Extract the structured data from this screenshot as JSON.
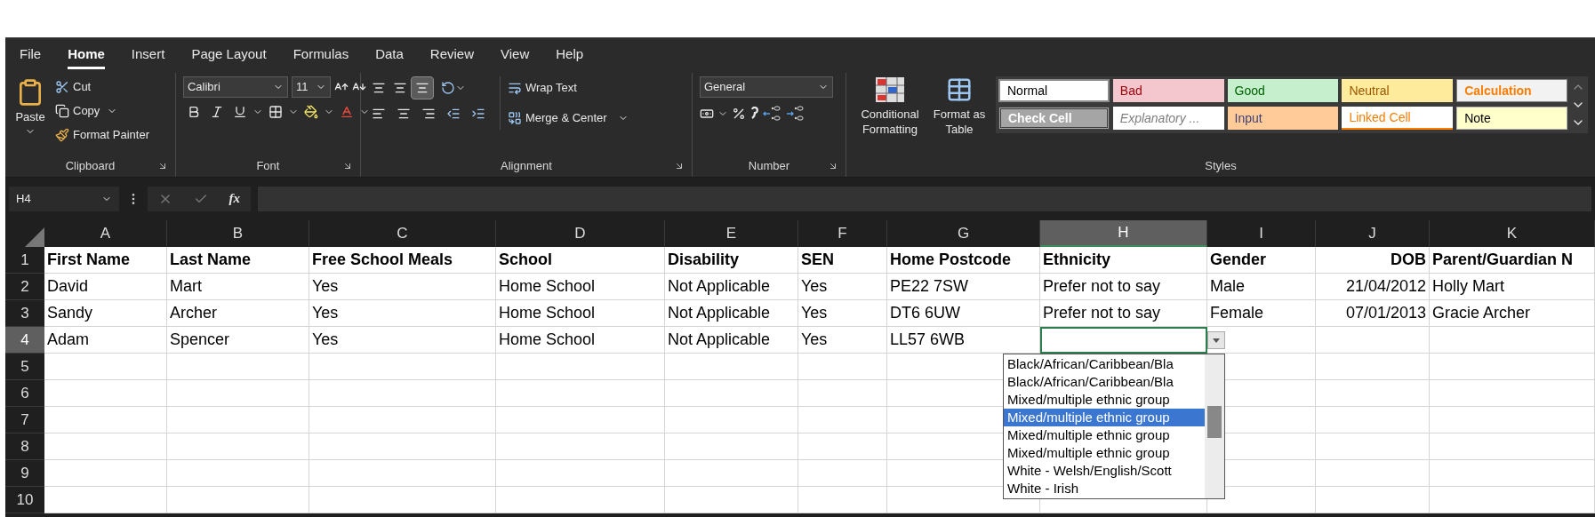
{
  "menu_tabs": [
    {
      "label": "File",
      "selected": false
    },
    {
      "label": "Home",
      "selected": true
    },
    {
      "label": "Insert",
      "selected": false
    },
    {
      "label": "Page Layout",
      "selected": false
    },
    {
      "label": "Formulas",
      "selected": false
    },
    {
      "label": "Data",
      "selected": false
    },
    {
      "label": "Review",
      "selected": false
    },
    {
      "label": "View",
      "selected": false
    },
    {
      "label": "Help",
      "selected": false
    }
  ],
  "clipboard": {
    "paste": "Paste",
    "cut": "Cut",
    "copy": "Copy",
    "format_painter": "Format Painter",
    "label": "Clipboard"
  },
  "font": {
    "name": "Calibri",
    "size": "11",
    "label": "Font"
  },
  "alignment": {
    "vertical_align_buttons": [
      {
        "selected": false
      },
      {
        "selected": false
      },
      {
        "selected": true
      }
    ],
    "wrap_text": "Wrap Text",
    "merge": "Merge & Center",
    "label": "Alignment"
  },
  "number": {
    "format": "General",
    "label": "Number"
  },
  "styles": {
    "conditional_formatting": "Conditional Formatting",
    "format_as_table": "Format as Table",
    "label": "Styles",
    "gallery": [
      {
        "label": "Normal",
        "kind": "normal"
      },
      {
        "label": "Bad",
        "kind": "bad"
      },
      {
        "label": "Good",
        "kind": "good"
      },
      {
        "label": "Neutral",
        "kind": "neutral"
      },
      {
        "label": "Calculation",
        "kind": "calculation"
      },
      {
        "label": "Check Cell",
        "kind": "check"
      },
      {
        "label": "Explanatory ...",
        "kind": "explanatory"
      },
      {
        "label": "Input",
        "kind": "input"
      },
      {
        "label": "Linked Cell",
        "kind": "linked"
      },
      {
        "label": "Note",
        "kind": "note"
      }
    ]
  },
  "formula_bar": {
    "name_box": "H4",
    "function_label": "fx"
  },
  "sheet": {
    "columns": [
      {
        "letter": "A",
        "selected": false,
        "numeric": false
      },
      {
        "letter": "B",
        "selected": false,
        "numeric": false
      },
      {
        "letter": "C",
        "selected": false,
        "numeric": false
      },
      {
        "letter": "D",
        "selected": false,
        "numeric": false
      },
      {
        "letter": "E",
        "selected": false,
        "numeric": false
      },
      {
        "letter": "F",
        "selected": false,
        "numeric": false
      },
      {
        "letter": "G",
        "selected": false,
        "numeric": false
      },
      {
        "letter": "H",
        "selected": true,
        "numeric": false
      },
      {
        "letter": "I",
        "selected": false,
        "numeric": false
      },
      {
        "letter": "J",
        "selected": false,
        "numeric": true
      },
      {
        "letter": "K",
        "selected": false,
        "numeric": false
      }
    ],
    "header_row": {
      "number": "1",
      "selected": false,
      "cells": [
        "First Name",
        "Last Name",
        "Free School Meals",
        "School",
        "Disability",
        "SEN",
        "Home Postcode",
        "Ethnicity",
        "Gender",
        "DOB",
        "Parent/Guardian N"
      ]
    },
    "rows": [
      {
        "number": "2",
        "selected": false,
        "cells": [
          "David",
          "Mart",
          "Yes",
          "Home School",
          "Not Applicable",
          "Yes",
          "PE22 7SW",
          "Prefer not to say",
          "Male",
          "21/04/2012",
          "Holly Mart"
        ]
      },
      {
        "number": "3",
        "selected": false,
        "cells": [
          "Sandy",
          "Archer",
          "Yes",
          "Home School",
          "Not Applicable",
          "Yes",
          "DT6 6UW",
          "Prefer not to say",
          "Female",
          "07/01/2013",
          "Gracie Archer"
        ]
      },
      {
        "number": "4",
        "selected": true,
        "cells": [
          "Adam",
          "Spencer",
          "Yes",
          "Home School",
          "Not Applicable",
          "Yes",
          "LL57 6WB",
          "",
          "",
          "",
          ""
        ]
      },
      {
        "number": "5",
        "selected": false
      },
      {
        "number": "6",
        "selected": false
      },
      {
        "number": "7",
        "selected": false
      },
      {
        "number": "8",
        "selected": false
      },
      {
        "number": "9",
        "selected": false
      },
      {
        "number": "10",
        "selected": false
      }
    ],
    "dropdown": {
      "items": [
        {
          "label": "Black/African/Caribbean/Bla",
          "selected": false
        },
        {
          "label": "Black/African/Caribbean/Bla",
          "selected": false
        },
        {
          "label": "Mixed/multiple ethnic group",
          "selected": false
        },
        {
          "label": "Mixed/multiple ethnic group",
          "selected": true
        },
        {
          "label": "Mixed/multiple ethnic group",
          "selected": false
        },
        {
          "label": "Mixed/multiple ethnic group",
          "selected": false
        },
        {
          "label": "White - Welsh/English/Scott",
          "selected": false
        },
        {
          "label": "White - Irish",
          "selected": false
        }
      ]
    }
  }
}
